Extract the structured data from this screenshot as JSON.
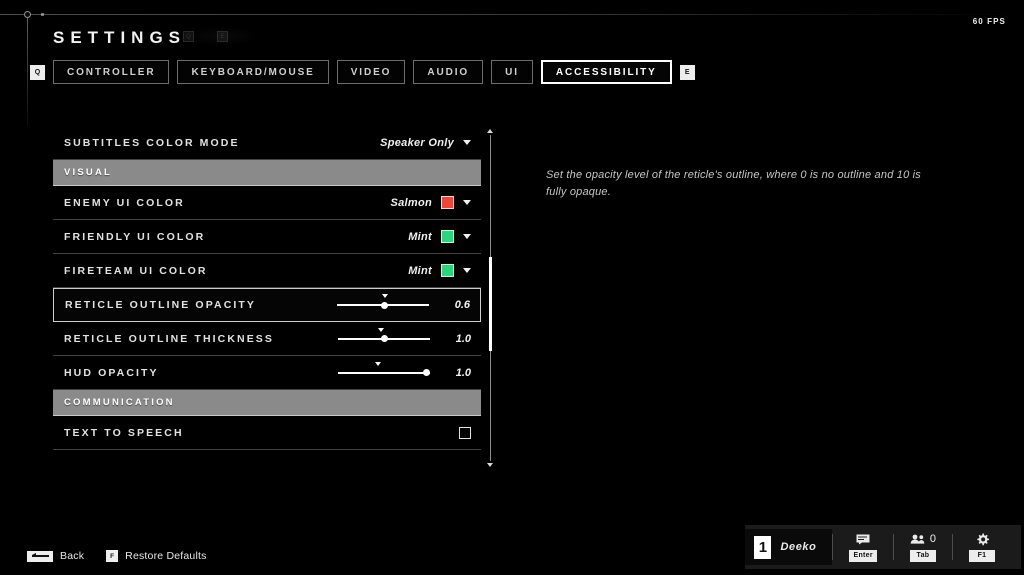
{
  "header": {
    "title": "SETTINGS",
    "fps": "60 FPS",
    "dim_banner": "",
    "hint_keys": [
      "Q",
      "E"
    ]
  },
  "tabs": {
    "left_key": "Q",
    "right_key": "E",
    "items": [
      {
        "label": "CONTROLLER",
        "active": false
      },
      {
        "label": "KEYBOARD/MOUSE",
        "active": false
      },
      {
        "label": "VIDEO",
        "active": false
      },
      {
        "label": "AUDIO",
        "active": false
      },
      {
        "label": "UI",
        "active": false
      },
      {
        "label": "ACCESSIBILITY",
        "active": true
      }
    ]
  },
  "settings_list": {
    "rows": [
      {
        "type": "dropdown",
        "label": "SUBTITLES COLOR MODE",
        "value": "Speaker Only",
        "selected": false
      },
      {
        "type": "section",
        "label": "VISUAL"
      },
      {
        "type": "color",
        "label": "ENEMY UI COLOR",
        "value": "Salmon",
        "color": "#e8493b",
        "selected": false
      },
      {
        "type": "color",
        "label": "FRIENDLY UI COLOR",
        "value": "Mint",
        "color": "#2fd37d",
        "selected": false
      },
      {
        "type": "color",
        "label": "FIRETEAM UI COLOR",
        "value": "Mint",
        "color": "#2fd37d",
        "selected": false
      },
      {
        "type": "slider",
        "label": "RETICLE OUTLINE OPACITY",
        "value": "0.6",
        "fill_pct": 52,
        "tick_pct": 52,
        "selected": true
      },
      {
        "type": "slider",
        "label": "RETICLE OUTLINE THICKNESS",
        "value": "1.0",
        "fill_pct": 50,
        "tick_pct": 47,
        "selected": false
      },
      {
        "type": "slider",
        "label": "HUD OPACITY",
        "value": "1.0",
        "fill_pct": 96,
        "tick_pct": 44,
        "selected": false
      },
      {
        "type": "section",
        "label": "COMMUNICATION"
      },
      {
        "type": "checkbox",
        "label": "TEXT TO SPEECH",
        "checked": false,
        "selected": false
      }
    ],
    "scrollbar": {
      "thumb_top_pct": 36,
      "thumb_height_pct": 28
    }
  },
  "description": {
    "text": "Set the opacity level of the reticle's outline, where 0 is no outline and 10 is fully opaque."
  },
  "bottom_bar": {
    "back_label": "Back",
    "restore_label": "Restore Defaults",
    "restore_key": "F"
  },
  "hud": {
    "rank": "1",
    "player_name": "Deeko",
    "chat_key": "Enter",
    "players_count": "0",
    "players_key": "Tab",
    "settings_key": "F1"
  }
}
